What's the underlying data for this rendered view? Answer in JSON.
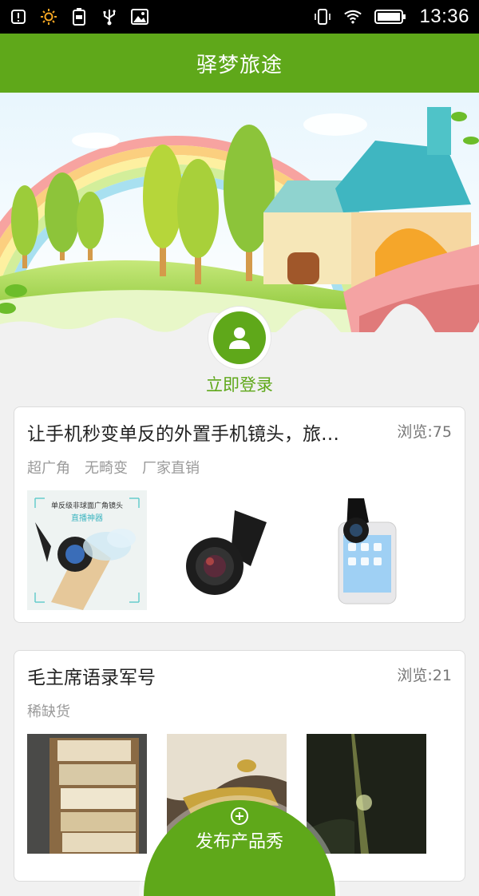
{
  "status_bar": {
    "time": "13:36",
    "icons_left": [
      "notification-icon",
      "brightness-icon",
      "battery-saver-icon",
      "usb-icon",
      "image-icon"
    ],
    "icons_right": [
      "vibrate-icon",
      "wifi-icon",
      "battery-icon"
    ]
  },
  "header": {
    "title": "驿梦旅途"
  },
  "login": {
    "label": "立即登录"
  },
  "posts": [
    {
      "title": "让手机秒变单反的外置手机镜头，旅…",
      "views": "浏览:75",
      "tags": [
        "超广角",
        "无畸变",
        "厂家直销"
      ],
      "thumb1_text_line1": "单反级非球面广角镜头",
      "thumb1_text_line2": "直播神器"
    },
    {
      "title": "毛主席语录军号",
      "views": "浏览:21",
      "tags": [
        "稀缺货"
      ]
    }
  ],
  "publish_button": {
    "label": "发布产品秀"
  },
  "colors": {
    "primary": "#5fa81a",
    "status_bar": "#000000",
    "background": "#f1f1f1"
  }
}
